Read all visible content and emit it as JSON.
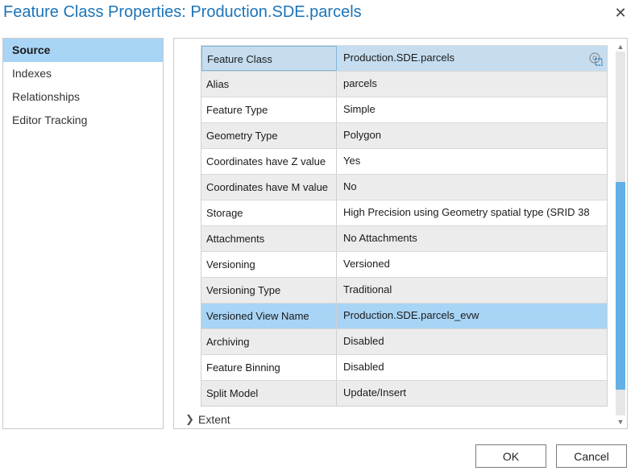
{
  "dialog": {
    "title": "Feature Class Properties: Production.SDE.parcels",
    "close_icon": "close-icon"
  },
  "sidebar": {
    "items": [
      {
        "label": "Source",
        "selected": true
      },
      {
        "label": "Indexes"
      },
      {
        "label": "Relationships"
      },
      {
        "label": "Editor Tracking"
      }
    ]
  },
  "properties": {
    "rows": [
      {
        "name": "Feature Class",
        "value": "Production.SDE.parcels"
      },
      {
        "name": "Alias",
        "value": "parcels"
      },
      {
        "name": "Feature Type",
        "value": "Simple"
      },
      {
        "name": "Geometry Type",
        "value": "Polygon"
      },
      {
        "name": "Coordinates have Z value",
        "value": "Yes"
      },
      {
        "name": "Coordinates have M value",
        "value": "No"
      },
      {
        "name": "Storage",
        "value": "High Precision using Geometry spatial type (SRID 38"
      },
      {
        "name": "Attachments",
        "value": "No Attachments"
      },
      {
        "name": "Versioning",
        "value": "Versioned"
      },
      {
        "name": "Versioning Type",
        "value": "Traditional"
      },
      {
        "name": "Versioned View Name",
        "value": "Production.SDE.parcels_evw"
      },
      {
        "name": "Archiving",
        "value": "Disabled"
      },
      {
        "name": "Feature Binning",
        "value": "Disabled"
      },
      {
        "name": "Split Model",
        "value": "Update/Insert"
      }
    ]
  },
  "extent": {
    "label": "Extent",
    "icon": "chevron-right-icon"
  },
  "buttons": {
    "ok": "OK",
    "cancel": "Cancel"
  },
  "colors": {
    "title": "#1c74b9",
    "selected": "#a8d4f5",
    "focused_row": "#c5ddef",
    "scroll_thumb": "#63b0e6",
    "alt_row": "#ececec"
  }
}
